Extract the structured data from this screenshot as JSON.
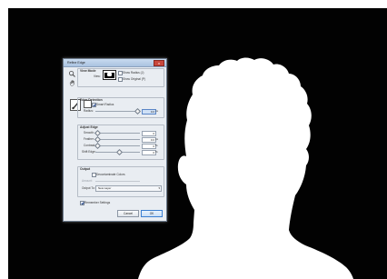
{
  "dialog": {
    "title": "Refine Edge",
    "close_label": "x",
    "view_mode": {
      "heading": "View Mode",
      "view_label": "View:",
      "show_radius_label": "Show Radius (J)",
      "show_original_label": "Show Original (P)"
    },
    "edge_detection": {
      "heading": "Edge Detection",
      "smart_radius_label": "Smart Radius",
      "radius_label": "Radius:",
      "radius_value": "0.0",
      "radius_unit": "px"
    },
    "adjust_edge": {
      "heading": "Adjust Edge",
      "smooth_label": "Smooth:",
      "smooth_value": "0",
      "feather_label": "Feather:",
      "feather_value": "0.0",
      "feather_unit": "px",
      "contrast_label": "Contrast:",
      "contrast_value": "0",
      "contrast_unit": "%",
      "shift_edge_label": "Shift Edge:",
      "shift_edge_value": "0",
      "shift_edge_unit": "%"
    },
    "output": {
      "heading": "Output",
      "decontaminate_label": "Decontaminate Colors",
      "amount_label": "Amount:",
      "output_to_label": "Output To:",
      "output_to_value": "New Layer"
    },
    "remember_label": "Remember Settings",
    "cancel_label": "Cancel",
    "ok_label": "OK",
    "icons": {
      "zoom": "zoom-icon",
      "hand": "hand-icon",
      "refine_brush": "refine-brush-icon"
    }
  },
  "colors": {
    "canvas_background": "#020202",
    "silhouette": "#ffffff",
    "dialog_background": "#e9edf2",
    "title_bar": "#b7cde8",
    "ok_button": "#c9def6"
  }
}
